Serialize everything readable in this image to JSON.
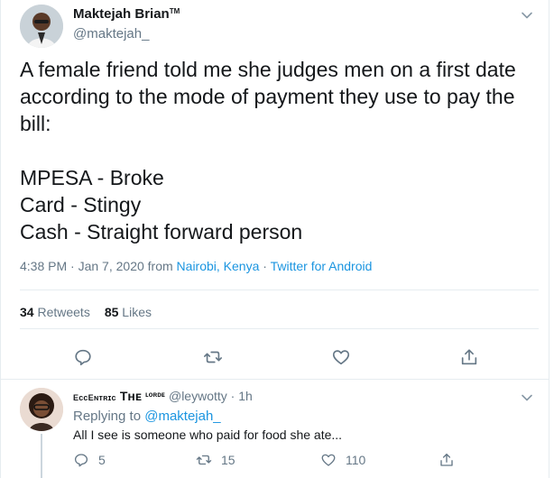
{
  "tweet": {
    "author_name": "Maktejah Brian",
    "author_badge": "TM",
    "author_handle": "@maktejah_",
    "text_lines": [
      "A female friend told me she judges men on a first date according to the mode of payment they use to pay the bill:",
      "MPESA - Broke",
      "Card - Stingy",
      "Cash - Straight forward person"
    ],
    "time": "4:38 PM",
    "date_sep": " · ",
    "date": "Jan 7, 2020",
    "from_label": " from ",
    "location": "Nairobi, Kenya",
    "source": "Twitter for Android",
    "retweets_count": "34",
    "retweets_label": " Retweets",
    "likes_count": "85",
    "likes_label": " Likes"
  },
  "reply": {
    "name_part1": "EᴄᴄEɴᴛʀɪᴄ",
    "name_part2": "Tʜᴇ",
    "name_part3": "ʟᴏʀᴅᴇ",
    "handle": "@leywotty",
    "age_sep": " · ",
    "age": "1h",
    "replying_label": "Replying to ",
    "replying_handle": "@maktejah_",
    "text": "All I see is someone who paid for food she ate...",
    "reply_count": "5",
    "retweet_count": "15",
    "like_count": "110"
  },
  "icons": {
    "reply": "reply-icon",
    "retweet": "retweet-icon",
    "like": "heart-icon",
    "share": "share-icon",
    "caret": "chevron-down-icon"
  },
  "colors": {
    "link": "#1b95e0",
    "muted": "#657786",
    "text": "#14171a",
    "border": "#e6ecf0"
  }
}
